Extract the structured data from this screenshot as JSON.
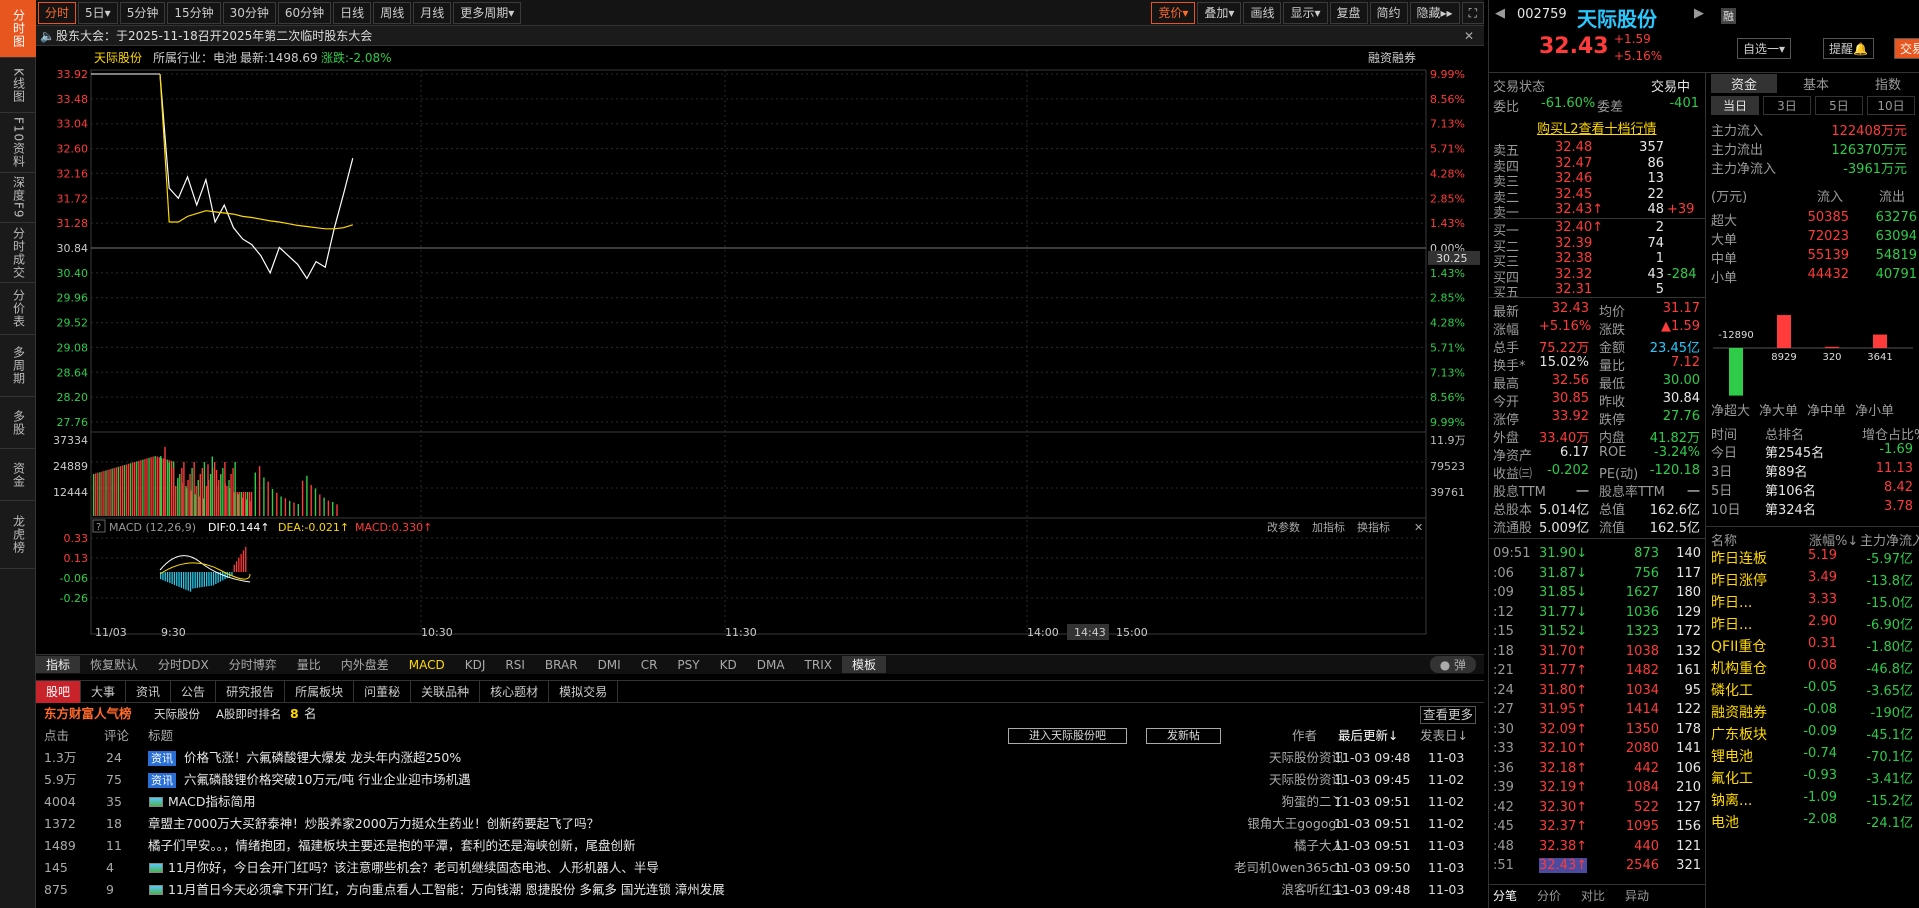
{
  "nav": [
    "分时图",
    "K线图",
    "F10资料",
    "深度F9",
    "分时成交",
    "分价表",
    "多周期",
    "多股",
    "资金",
    "龙虎榜"
  ],
  "toolbar": {
    "periods": [
      "分时",
      "5日▾",
      "5分钟",
      "15分钟",
      "30分钟",
      "60分钟",
      "日线",
      "周线",
      "月线",
      "更多周期▾"
    ],
    "right": [
      "竞价▾",
      "叠加▾",
      "画线",
      "显示▾",
      "复盘",
      "简约",
      "隐藏▸▸"
    ]
  },
  "notice": "股东大会：于2025-11-18召开2025年第二次临时股东大会",
  "chart_header": {
    "name": "天际股份",
    "industry": "所属行业：电池",
    "latest": "最新:1498.69",
    "change": "涨跌:-2.08%",
    "rzrq": "融资融券"
  },
  "price_axis": {
    "left": [
      "33.92",
      "33.48",
      "33.04",
      "32.60",
      "32.16",
      "31.72",
      "31.28",
      "30.84",
      "30.40",
      "29.96",
      "29.52",
      "29.08",
      "28.64",
      "28.20",
      "27.76"
    ],
    "right": [
      "9.99%",
      "8.56%",
      "7.13%",
      "5.71%",
      "4.28%",
      "2.85%",
      "1.43%",
      "0.00%",
      "1.43%",
      "2.85%",
      "4.28%",
      "5.71%",
      "7.13%",
      "8.56%",
      "9.99%"
    ],
    "cursor": "30.25"
  },
  "vol_axis": {
    "left": [
      "37334",
      "24889",
      "12444"
    ],
    "right": [
      "11.9万",
      "79523",
      "39761"
    ]
  },
  "macd": {
    "title": "MACD (12,26,9)",
    "dif": "DIF:0.144↑",
    "dea": "DEA:-0.021↑",
    "macd": "MACD:0.330↑",
    "axis": [
      "0.33",
      "0.13",
      "-0.06",
      "-0.26"
    ],
    "btns": [
      "改参数",
      "加指标",
      "换指标"
    ]
  },
  "time_axis": [
    "11/03",
    "9:30",
    "10:30",
    "11:30",
    "14:00",
    "14:43",
    "15:00"
  ],
  "chart_data": {
    "type": "line",
    "x": [
      "9:30",
      "9:31",
      "9:32",
      "9:33",
      "9:34",
      "9:35",
      "9:36",
      "9:37",
      "9:38",
      "9:39",
      "9:40",
      "9:41",
      "9:42",
      "9:43",
      "9:44",
      "9:45",
      "9:46",
      "9:47",
      "9:48",
      "9:49",
      "9:50",
      "9:51"
    ],
    "series": [
      {
        "values": [
          33.92,
          31.9,
          31.72,
          32.1,
          31.6,
          32.05,
          31.3,
          31.6,
          31.2,
          31.0,
          30.9,
          30.7,
          30.4,
          30.85,
          30.7,
          30.55,
          30.3,
          30.6,
          30.5,
          31.2,
          31.8,
          32.43
        ]
      },
      {
        "values": [
          33.92,
          31.3,
          31.3,
          31.4,
          31.45,
          31.5,
          31.48,
          31.46,
          31.44,
          31.4,
          31.38,
          31.35,
          31.32,
          31.3,
          31.27,
          31.24,
          31.22,
          31.2,
          31.18,
          31.18,
          31.2,
          31.25
        ]
      }
    ],
    "ylim": [
      27.76,
      33.92
    ]
  },
  "indicators": [
    "指标",
    "恢复默认",
    "分时DDX",
    "分时博弈",
    "量比",
    "内外盘差",
    "MACD",
    "KDJ",
    "RSI",
    "BRAR",
    "DMI",
    "CR",
    "PSY",
    "KD",
    "DMA",
    "TRIX",
    "模板"
  ],
  "toggle": "弹",
  "guba": {
    "tabs": [
      "股吧",
      "大事",
      "资讯",
      "公告",
      "研究报告",
      "所属板块",
      "问董秘",
      "关联品种",
      "核心题材",
      "模拟交易"
    ],
    "rank_title": "东方财富人气榜",
    "rank_stock": "天际股份",
    "rank_label": "A股即时排名",
    "rank_num": "8",
    "rank_unit": "名",
    "more": "查看更多",
    "cols": [
      "点击",
      "评论",
      "标题",
      "作者",
      "最后更新↓",
      "发表日↓"
    ],
    "btn1": "进入天际股份吧",
    "btn2": "发新帖",
    "rows": [
      {
        "click": "1.3万",
        "cmt": "24",
        "tag": "资讯",
        "title": "价格飞涨！六氟磷酸锂大爆发 龙头年内涨超250%",
        "author": "天际股份资讯",
        "upd": "11-03 09:48",
        "pub": "11-03"
      },
      {
        "click": "5.9万",
        "cmt": "75",
        "tag": "资讯",
        "title": "六氟磷酸锂价格突破10万元/吨 行业企业迎市场机遇",
        "author": "天际股份资讯",
        "upd": "11-03 09:45",
        "pub": "11-02"
      },
      {
        "click": "4004",
        "cmt": "35",
        "tag": "img",
        "title": "MACD指标简用",
        "author": "狗蛋的二丫",
        "upd": "11-03 09:51",
        "pub": "11-02"
      },
      {
        "click": "1372",
        "cmt": "18",
        "tag": "",
        "title": "章盟主7000万大买舒泰神！炒股养家2000万力挺众生药业！创新药要起飞了吗？",
        "author": "银角大王gogogo",
        "upd": "11-03 09:51",
        "pub": "11-02"
      },
      {
        "click": "1489",
        "cmt": "11",
        "tag": "",
        "title": "橘子们早安。。，情绪抱团，福建板块主要还是抱的平潭，套利的还是海峡创新，尾盘创新",
        "author": "橘子大人",
        "upd": "11-03 09:51",
        "pub": "11-03"
      },
      {
        "click": "145",
        "cmt": "4",
        "tag": "img",
        "title": "11月你好，今日会开门红吗？该注意哪些机会？老司机继续固态电池、人形机器人、半导",
        "author": "老司机0wen365ch",
        "upd": "11-03 09:50",
        "pub": "11-03"
      },
      {
        "click": "875",
        "cmt": "9",
        "tag": "img",
        "title": "11月首日今天必须拿下开门红，方向重点看人工智能：万向钱潮 恩捷股份 多氟多 国光连锁 漳州发展",
        "author": "浪客听红尘",
        "upd": "11-03 09:48",
        "pub": "11-03"
      }
    ]
  },
  "quote": {
    "code": "002759",
    "name": "天际股份",
    "price": "32.43",
    "chg": "+1.59",
    "pct": "+5.16%",
    "btns": [
      "自选一▾",
      "提醒🔔",
      "交易▸"
    ],
    "badge": "融",
    "status_label": "交易状态",
    "status": "交易中",
    "wb_label": "委比",
    "wb": "-61.60%",
    "wc_label": "委差",
    "wc": "-401",
    "l2": "购买L2查看十档行情",
    "asks": [
      [
        "卖五",
        "32.48",
        "357",
        ""
      ],
      [
        "卖四",
        "32.47",
        "86",
        ""
      ],
      [
        "卖三",
        "32.46",
        "13",
        ""
      ],
      [
        "卖二",
        "32.45",
        "22",
        ""
      ],
      [
        "卖一",
        "32.43↑",
        "48",
        "+39"
      ]
    ],
    "bids": [
      [
        "买一",
        "32.40↑",
        "2",
        ""
      ],
      [
        "买二",
        "32.39",
        "74",
        ""
      ],
      [
        "买三",
        "32.38",
        "1",
        ""
      ],
      [
        "买四",
        "32.32",
        "43",
        "-284"
      ],
      [
        "买五",
        "32.31",
        "5",
        ""
      ]
    ],
    "stats": [
      [
        "最新",
        "32.43",
        "均价",
        "31.17"
      ],
      [
        "涨幅",
        "+5.16%",
        "涨跌",
        "▲1.59"
      ],
      [
        "总手",
        "75.22万",
        "金额",
        "23.45亿"
      ],
      [
        "换手*",
        "15.02%",
        "量比",
        "7.12"
      ],
      [
        "最高",
        "32.56",
        "最低",
        "30.00"
      ],
      [
        "今开",
        "30.85",
        "昨收",
        "30.84"
      ],
      [
        "涨停",
        "33.92",
        "跌停",
        "27.76"
      ],
      [
        "外盘",
        "33.40万",
        "内盘",
        "41.82万"
      ],
      [
        "净资产",
        "6.17",
        "ROE",
        "-3.24%"
      ],
      [
        "收益㈢",
        "-0.202",
        "PE(动)",
        "-120.18"
      ],
      [
        "股息TTM",
        "一",
        "股息率TTM",
        "一"
      ],
      [
        "总股本",
        "5.014亿",
        "总值",
        "162.6亿"
      ],
      [
        "流通股",
        "5.009亿",
        "流值",
        "162.5亿"
      ]
    ],
    "ticks": [
      [
        "09:51",
        "31.90↓",
        "873",
        "140"
      ],
      [
        ":06",
        "31.87↓",
        "756",
        "117"
      ],
      [
        ":09",
        "31.85↓",
        "1627",
        "180"
      ],
      [
        ":12",
        "31.77↓",
        "1036",
        "129"
      ],
      [
        ":15",
        "31.52↓",
        "1323",
        "172"
      ],
      [
        ":18",
        "31.70↑",
        "1038",
        "132"
      ],
      [
        ":21",
        "31.77↑",
        "1482",
        "161"
      ],
      [
        ":24",
        "31.80↑",
        "1034",
        "95"
      ],
      [
        ":27",
        "31.95↑",
        "1414",
        "122"
      ],
      [
        ":30",
        "32.09↑",
        "1350",
        "178"
      ],
      [
        ":33",
        "32.10↑",
        "2080",
        "141"
      ],
      [
        ":36",
        "32.18↑",
        "442",
        "106"
      ],
      [
        ":39",
        "32.19↑",
        "1084",
        "210"
      ],
      [
        ":42",
        "32.30↑",
        "522",
        "127"
      ],
      [
        ":45",
        "32.37↑",
        "1095",
        "156"
      ],
      [
        ":48",
        "32.38↑",
        "440",
        "121"
      ],
      [
        ":51",
        "32.43↑",
        "2546",
        "321"
      ]
    ],
    "bottom_tabs": [
      "分笔",
      "分价",
      "对比",
      "异动"
    ]
  },
  "fund": {
    "tabs": [
      "资金",
      "基本",
      "指数"
    ],
    "sub": [
      "当日",
      "3日",
      "5日",
      "10日"
    ],
    "rows": [
      [
        "主力流入",
        "122408万元"
      ],
      [
        "主力流出",
        "126370万元"
      ],
      [
        "主力净流入",
        "-3961万元"
      ]
    ],
    "head": [
      "(万元)",
      "流入",
      "流出"
    ],
    "table": [
      [
        "超大",
        "50385",
        "63276"
      ],
      [
        "大单",
        "72023",
        "63094"
      ],
      [
        "中单",
        "55139",
        "54819"
      ],
      [
        "小单",
        "44432",
        "40791"
      ]
    ],
    "bars": [
      [
        "净超大",
        "-12890"
      ],
      [
        "净大单",
        "8929"
      ],
      [
        "净中单",
        "320"
      ],
      [
        "净小单",
        "3641"
      ]
    ],
    "rank_head": [
      "时间",
      "总排名",
      "增仓占比%"
    ],
    "rank": [
      [
        "今日",
        "第2545名",
        "-1.69"
      ],
      [
        "3日",
        "第89名",
        "11.13"
      ],
      [
        "5日",
        "第106名",
        "8.42"
      ],
      [
        "10日",
        "第324名",
        "3.78"
      ]
    ],
    "sect_head": [
      "名称",
      "涨幅%↓",
      "主力净流入"
    ],
    "sectors": [
      [
        "昨日连板",
        "5.19",
        "-5.97亿"
      ],
      [
        "昨日涨停",
        "3.49",
        "-13.8亿"
      ],
      [
        "昨日...",
        "3.33",
        "-15.0亿"
      ],
      [
        "昨日...",
        "2.90",
        "-6.90亿"
      ],
      [
        "QFII重仓",
        "0.31",
        "-1.80亿"
      ],
      [
        "机构重仓",
        "0.08",
        "-46.8亿"
      ],
      [
        "磷化工",
        "-0.05",
        "-3.65亿"
      ],
      [
        "融资融券",
        "-0.08",
        "-190亿"
      ],
      [
        "广东板块",
        "-0.09",
        "-45.1亿"
      ],
      [
        "锂电池",
        "-0.74",
        "-70.1亿"
      ],
      [
        "氟化工",
        "-0.93",
        "-3.41亿"
      ],
      [
        "钠离...",
        "-1.09",
        "-15.2亿"
      ],
      [
        "电池",
        "-2.08",
        "-24.1亿"
      ]
    ]
  },
  "colors": {
    "up": "#ff3b3b",
    "down": "#2fcc4a",
    "accent": "#e8561f",
    "price": "#ffffff",
    "avg": "#ffd800"
  }
}
